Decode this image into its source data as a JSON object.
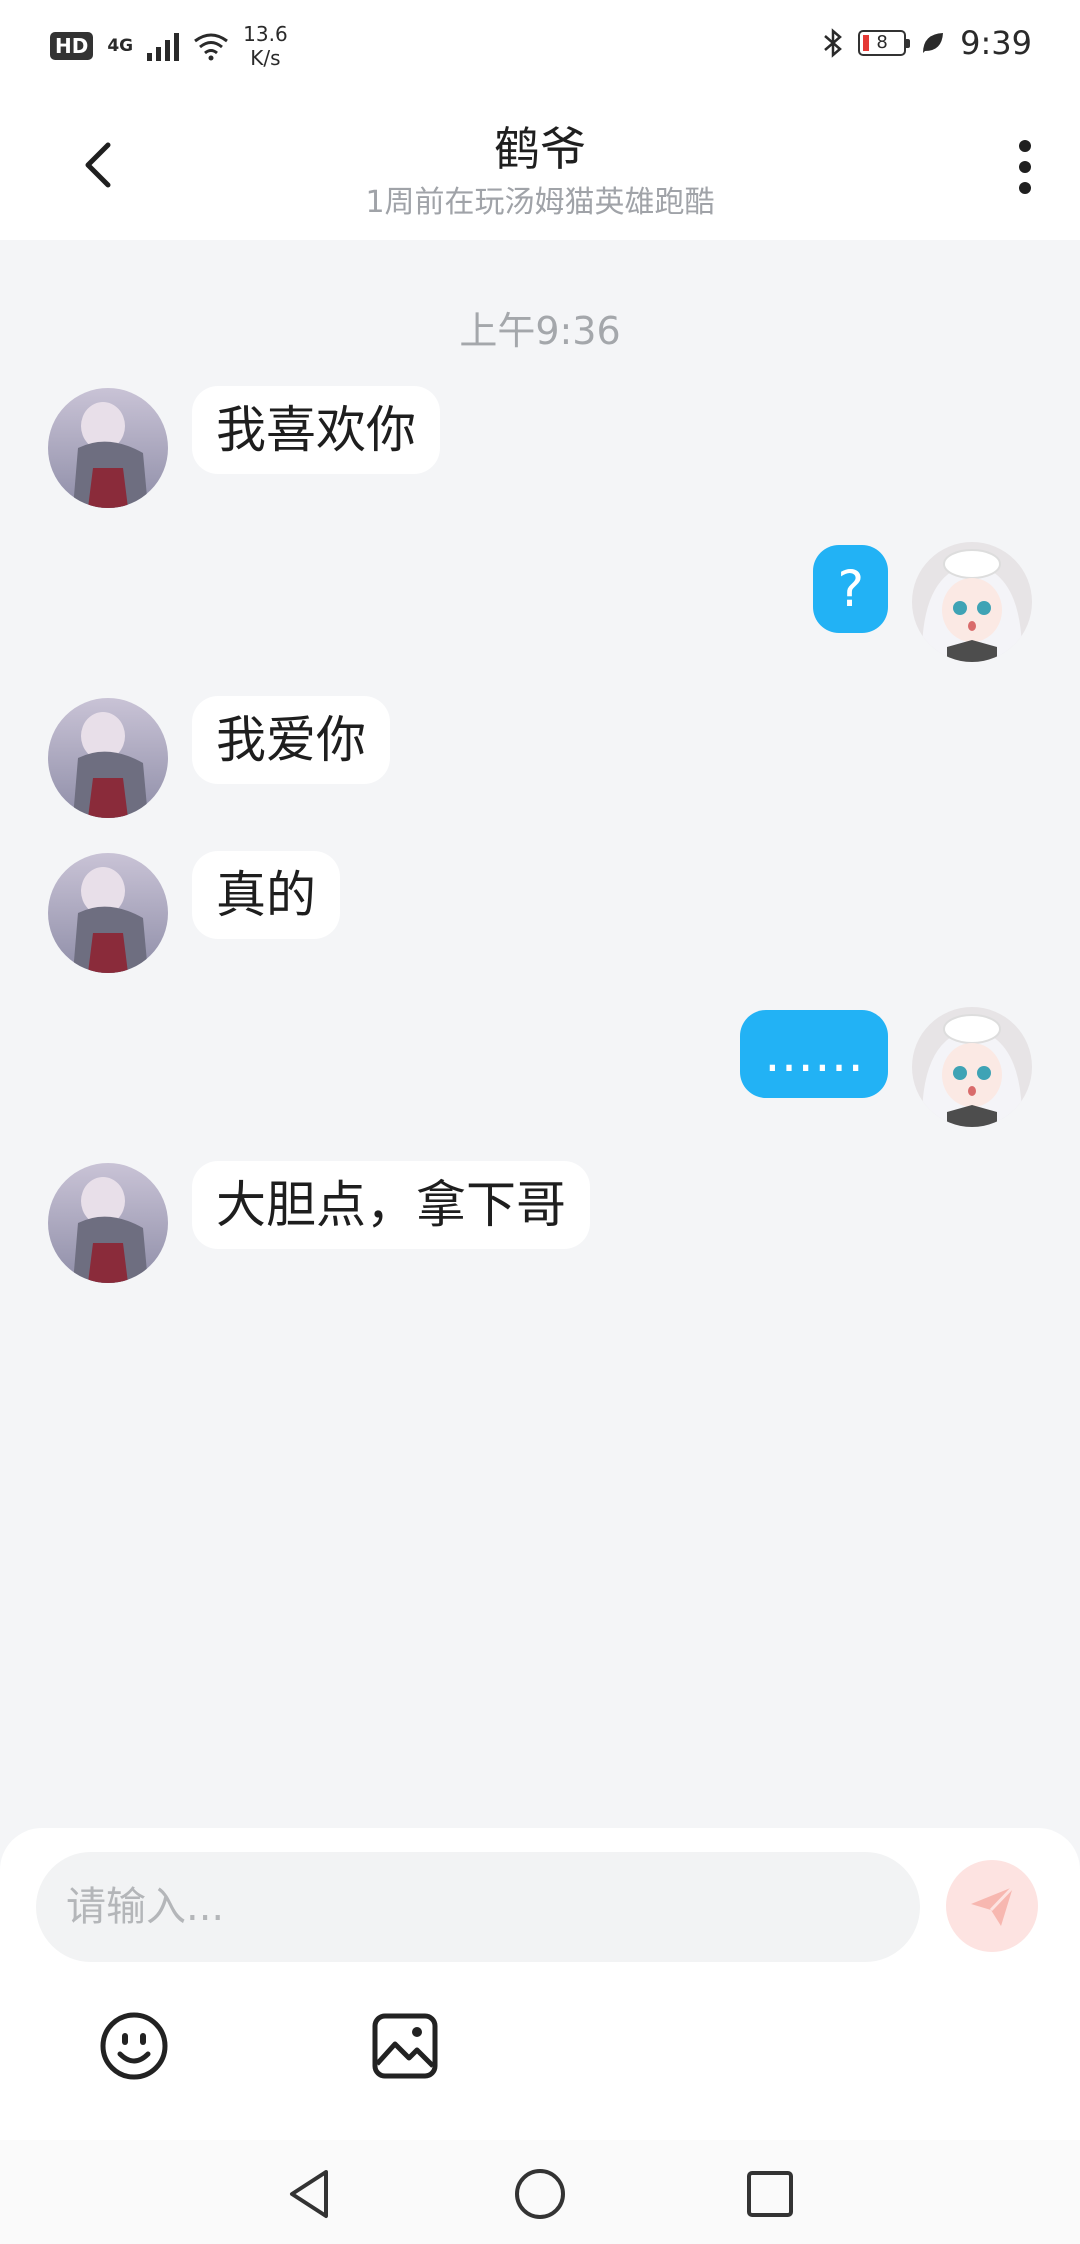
{
  "status_bar": {
    "hd": "HD",
    "network": "4G",
    "speed_value": "13.6",
    "speed_unit": "K/s",
    "battery_level": "8",
    "time": "9:39"
  },
  "header": {
    "title": "鹤爷",
    "subtitle": "1周前在玩汤姆猫英雄跑酷"
  },
  "chat": {
    "timestamp": "上午9:36",
    "messages": [
      {
        "side": "left",
        "text": "我喜欢你"
      },
      {
        "side": "right",
        "text": "?"
      },
      {
        "side": "left",
        "text": "我爱你"
      },
      {
        "side": "left",
        "text": "真的"
      },
      {
        "side": "right",
        "text": "……"
      },
      {
        "side": "left",
        "text": "大胆点，拿下哥"
      }
    ]
  },
  "composer": {
    "placeholder": "请输入..."
  },
  "icons": {
    "back": "chevron-left-icon",
    "more": "more-vertical-icon",
    "send": "send-icon",
    "emoji": "emoji-icon",
    "image": "image-icon"
  },
  "colors": {
    "accent": "#22b2f5",
    "send_bg": "#fde3e1",
    "send_icon": "#f7b7b0",
    "background": "#f4f5f7"
  }
}
